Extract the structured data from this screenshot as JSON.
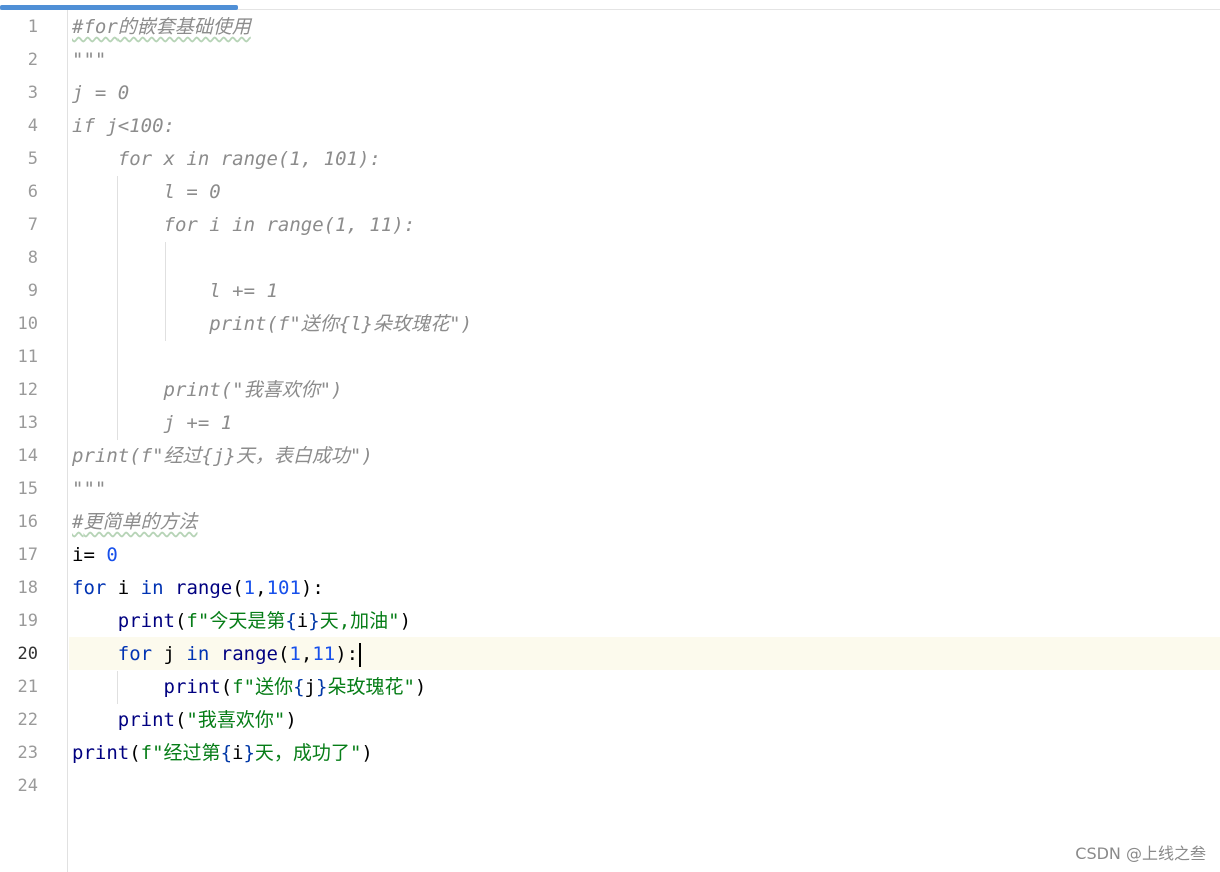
{
  "editor": {
    "watermark": "CSDN @上线之叁",
    "current_line": 20
  },
  "line_numbers": [
    "1",
    "2",
    "3",
    "4",
    "5",
    "6",
    "7",
    "8",
    "9",
    "10",
    "11",
    "12",
    "13",
    "14",
    "15",
    "16",
    "17",
    "18",
    "19",
    "20",
    "21",
    "22",
    "23",
    "24"
  ],
  "lines": [
    "#for的嵌套基础使用",
    "\"\"\"",
    "j = 0",
    "if j<100:",
    "    for x in range(1, 101):",
    "        l = 0",
    "        for i in range(1, 11):",
    "",
    "            l += 1",
    "            print(f\"送你{l}朵玫瑰花\")",
    "",
    "        print(\"我喜欢你\")",
    "        j += 1",
    "print(f\"经过{j}天，表白成功\")",
    "\"\"\"",
    "#更简单的方法",
    "i= 0",
    "for i in range(1,101):",
    "    print(f\"今天是第{i}天,加油\")",
    "    for j in range(1,11):",
    "        print(f\"送你{j}朵玫瑰花\")",
    "    print(\"我喜欢你\")",
    "print(f\"经过第{i}天，成功了\")",
    ""
  ],
  "colors": {
    "comment": "#8c8c8c",
    "keyword": "#0033b3",
    "builtin": "#000080",
    "number": "#1750eb",
    "string": "#067d17",
    "current_line_bg": "#fcfaed"
  }
}
